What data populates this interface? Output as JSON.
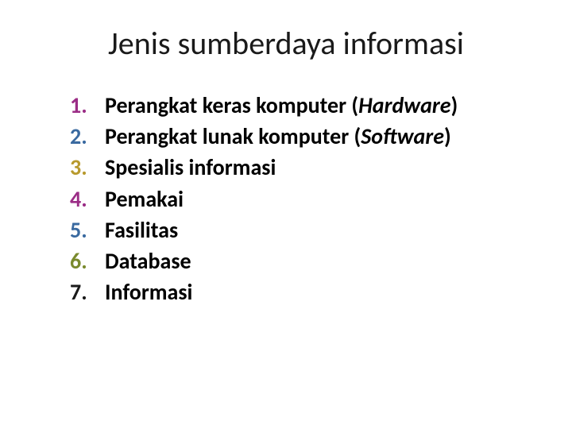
{
  "title": "Jenis sumberdaya informasi",
  "items": [
    {
      "pre": "Perangkat keras komputer (",
      "em": "Hardware",
      "post": ")",
      "num_color": "#9b2d86"
    },
    {
      "pre": "Perangkat lunak komputer (",
      "em": "Software",
      "post": ")",
      "num_color": "#3a6aa0"
    },
    {
      "pre": "Spesialis informasi",
      "em": "",
      "post": "",
      "num_color": "#b89a2e"
    },
    {
      "pre": "Pemakai",
      "em": "",
      "post": "",
      "num_color": "#9b2d86"
    },
    {
      "pre": "Fasilitas",
      "em": "",
      "post": "",
      "num_color": "#3a6aa0"
    },
    {
      "pre": "Database",
      "em": "",
      "post": "",
      "num_color": "#7a8a2e"
    },
    {
      "pre": "Informasi",
      "em": "",
      "post": "",
      "num_color": "#1a1a1a"
    }
  ]
}
